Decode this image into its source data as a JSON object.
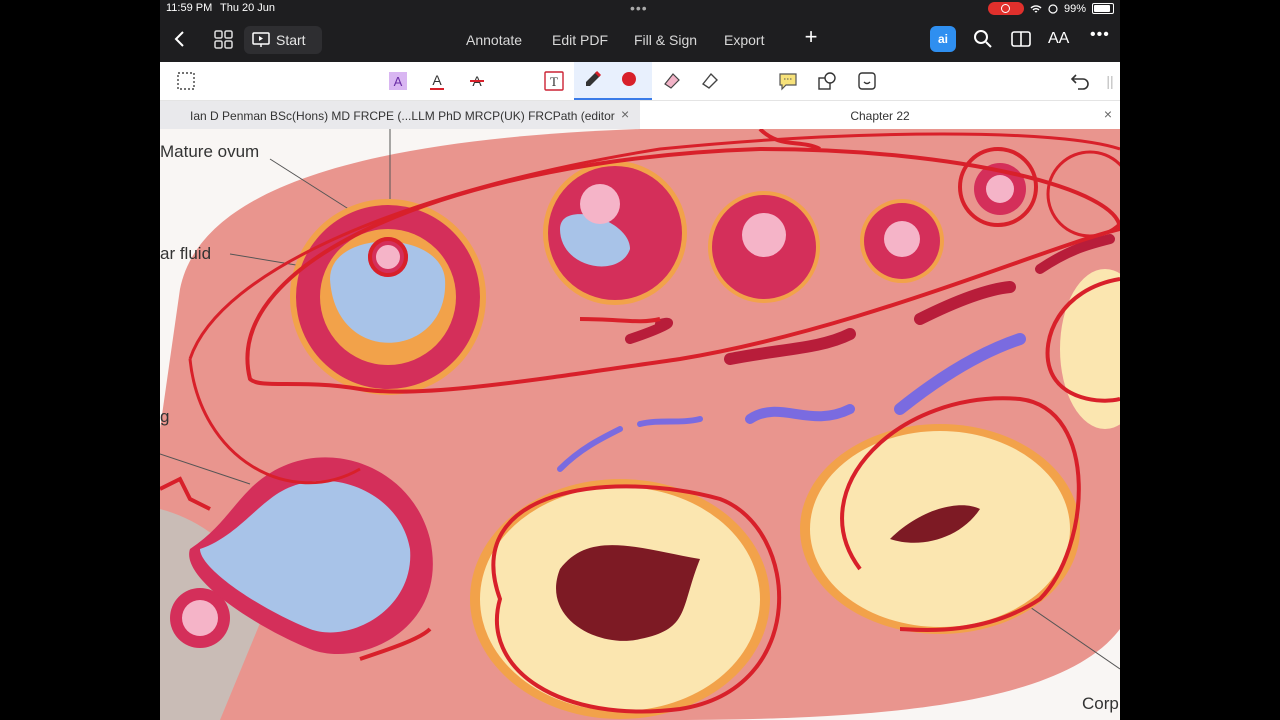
{
  "status_bar": {
    "time": "11:59 PM",
    "date": "Thu 20 Jun",
    "battery": "99%"
  },
  "top_nav": {
    "start_label": "Start",
    "menu": [
      "Annotate",
      "Edit PDF",
      "Fill & Sign",
      "Export"
    ],
    "ai_label": "ai",
    "font_size_label": "AA"
  },
  "tabs": [
    {
      "label": "Ian D Penman BSc(Hons) MD FRCPE (...LLM  PhD  MRCP(UK)  FRCPath (editor",
      "active": false
    },
    {
      "label": "Chapter 22",
      "active": true
    }
  ],
  "toolbar": {
    "tools": [
      "lasso-select",
      "highlight-text",
      "underline-text",
      "strikethrough-text",
      "text-box",
      "pen",
      "color-red",
      "highlighter-eraser",
      "eraser",
      "comment",
      "shapes",
      "sticker",
      "undo"
    ],
    "pen_color": "#d8202a"
  },
  "diagram_labels": {
    "mature_ovum": "Mature ovum",
    "fluid": "ar fluid",
    "left_g": "g",
    "corp": "Corp"
  },
  "colors": {
    "ovary": "#e9958e",
    "follicle": "#d42f5a",
    "corpus": "#fbe6b0",
    "annotation": "#d8202a",
    "vein": "#7a6be0"
  }
}
